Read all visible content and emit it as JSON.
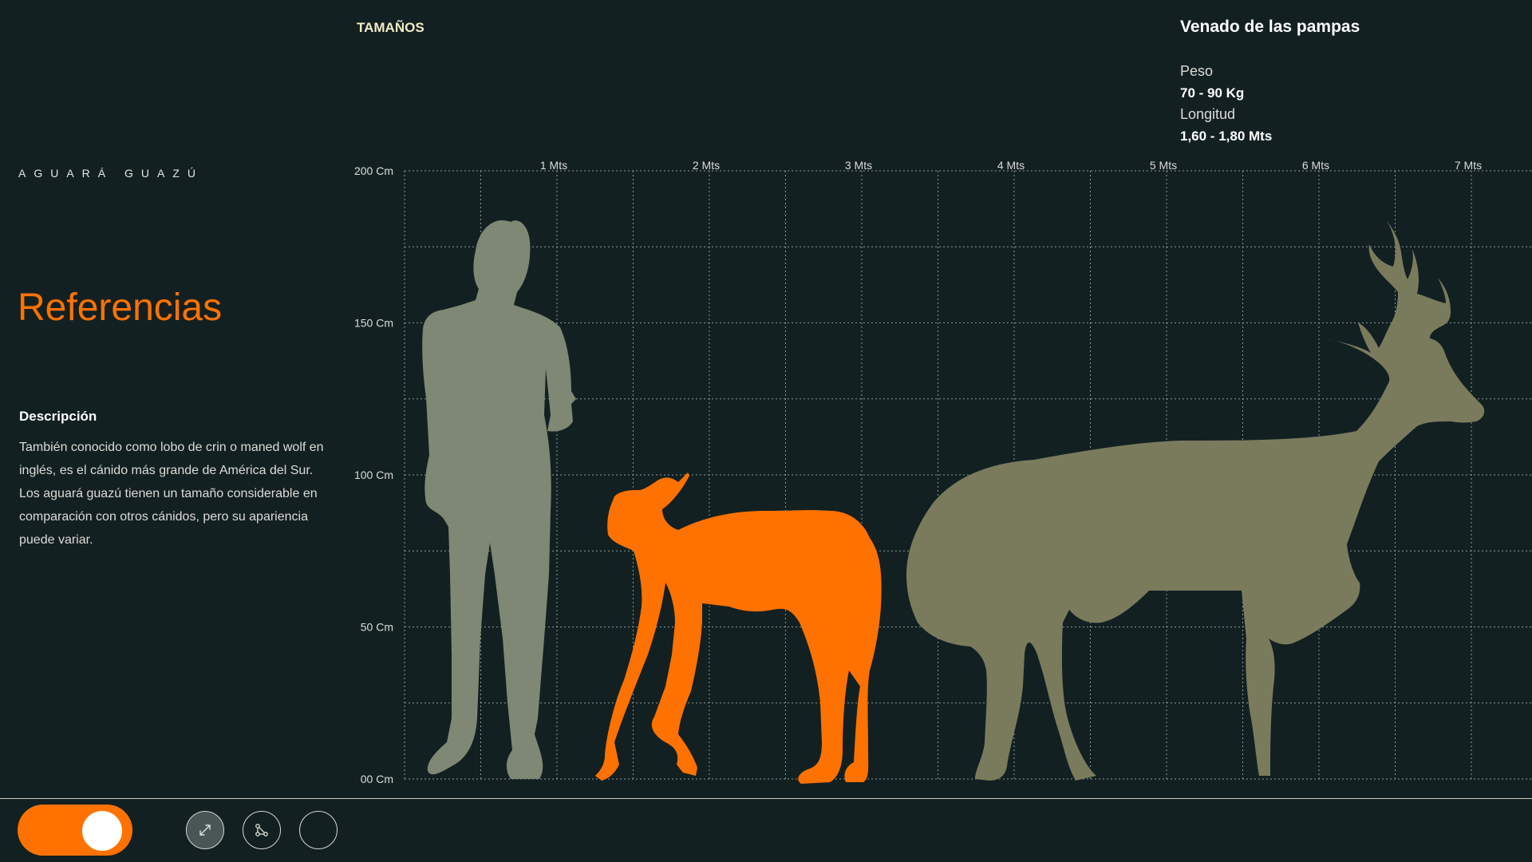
{
  "sidebar": {
    "brand": "AGUARÁ GUAZÚ",
    "title": "Referencias",
    "description_title": "Descripción",
    "description": "También conocido como lobo de crin o maned wolf en inglés, es el cánido más grande de América del Sur. Los aguará guazú tienen un tamaño considerable en comparación con otros cánidos, pero su apariencia puede variar."
  },
  "header": {
    "section_label": "TAMAÑOS"
  },
  "info": {
    "title": "Venado de las pampas",
    "weight_label": "Peso",
    "weight_value": "70 - 90 Kg",
    "length_label": "Longitud",
    "length_value": "1,60 - 1,80 Mts"
  },
  "chart_data": {
    "type": "table",
    "x_ticks": [
      "1 Mts",
      "2 Mts",
      "3 Mts",
      "4 Mts",
      "5 Mts",
      "6 Mts",
      "7 Mts"
    ],
    "y_ticks": [
      "200 Cm",
      "150 Cm",
      "100 Cm",
      "50 Cm",
      "00 Cm"
    ],
    "xlim": [
      0,
      7.5
    ],
    "ylim": [
      0,
      200
    ],
    "grid": true
  },
  "colors": {
    "background": "#132022",
    "accent": "#ff7200",
    "silhouette_gray": "#7f8874",
    "silhouette_deer": "#7a7b5d"
  },
  "icons": {
    "expand": "expand-icon",
    "nodes": "nodes-icon"
  }
}
